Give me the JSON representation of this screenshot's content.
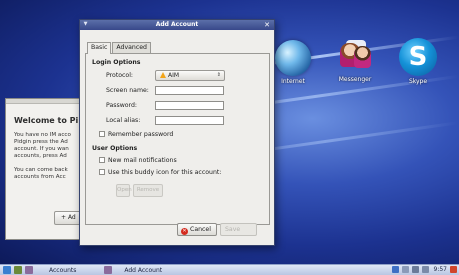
{
  "dialog": {
    "title": "Add Account",
    "tabs": [
      {
        "label": "Basic"
      },
      {
        "label": "Advanced"
      }
    ],
    "login_options_heading": "Login Options",
    "protocol_label": "Protocol:",
    "protocol_value": "AIM",
    "screen_name_label": "Screen name:",
    "screen_name_value": "",
    "password_label": "Password:",
    "password_value": "",
    "local_alias_label": "Local alias:",
    "local_alias_value": "",
    "remember_password_label": "Remember password",
    "user_options_heading": "User Options",
    "new_mail_label": "New mail notifications",
    "buddy_icon_label": "Use this buddy icon for this account:",
    "open_button_label": "Open",
    "remove_button_label": "Remove",
    "cancel_button_label": "Cancel",
    "save_button_label": "Save"
  },
  "background_window": {
    "heading": "Welcome to Pi",
    "para1_lines": [
      "You have no IM acco",
      "Pidgin press the Ad",
      "account. If you wan",
      "accounts, press Ad"
    ],
    "para2_lines": [
      "You can come back",
      "accounts from Acc"
    ],
    "add_button_label": "Ad"
  },
  "desktop_icons": [
    {
      "label": "Internet",
      "icon": "globe-icon"
    },
    {
      "label": "Messenger",
      "icon": "messenger-icon"
    },
    {
      "label": "Skype",
      "icon": "skype-icon",
      "glyph": "S"
    }
  ],
  "taskbar": {
    "tasks": [
      "Accounts",
      "Add Account"
    ],
    "clock": "9:57"
  }
}
